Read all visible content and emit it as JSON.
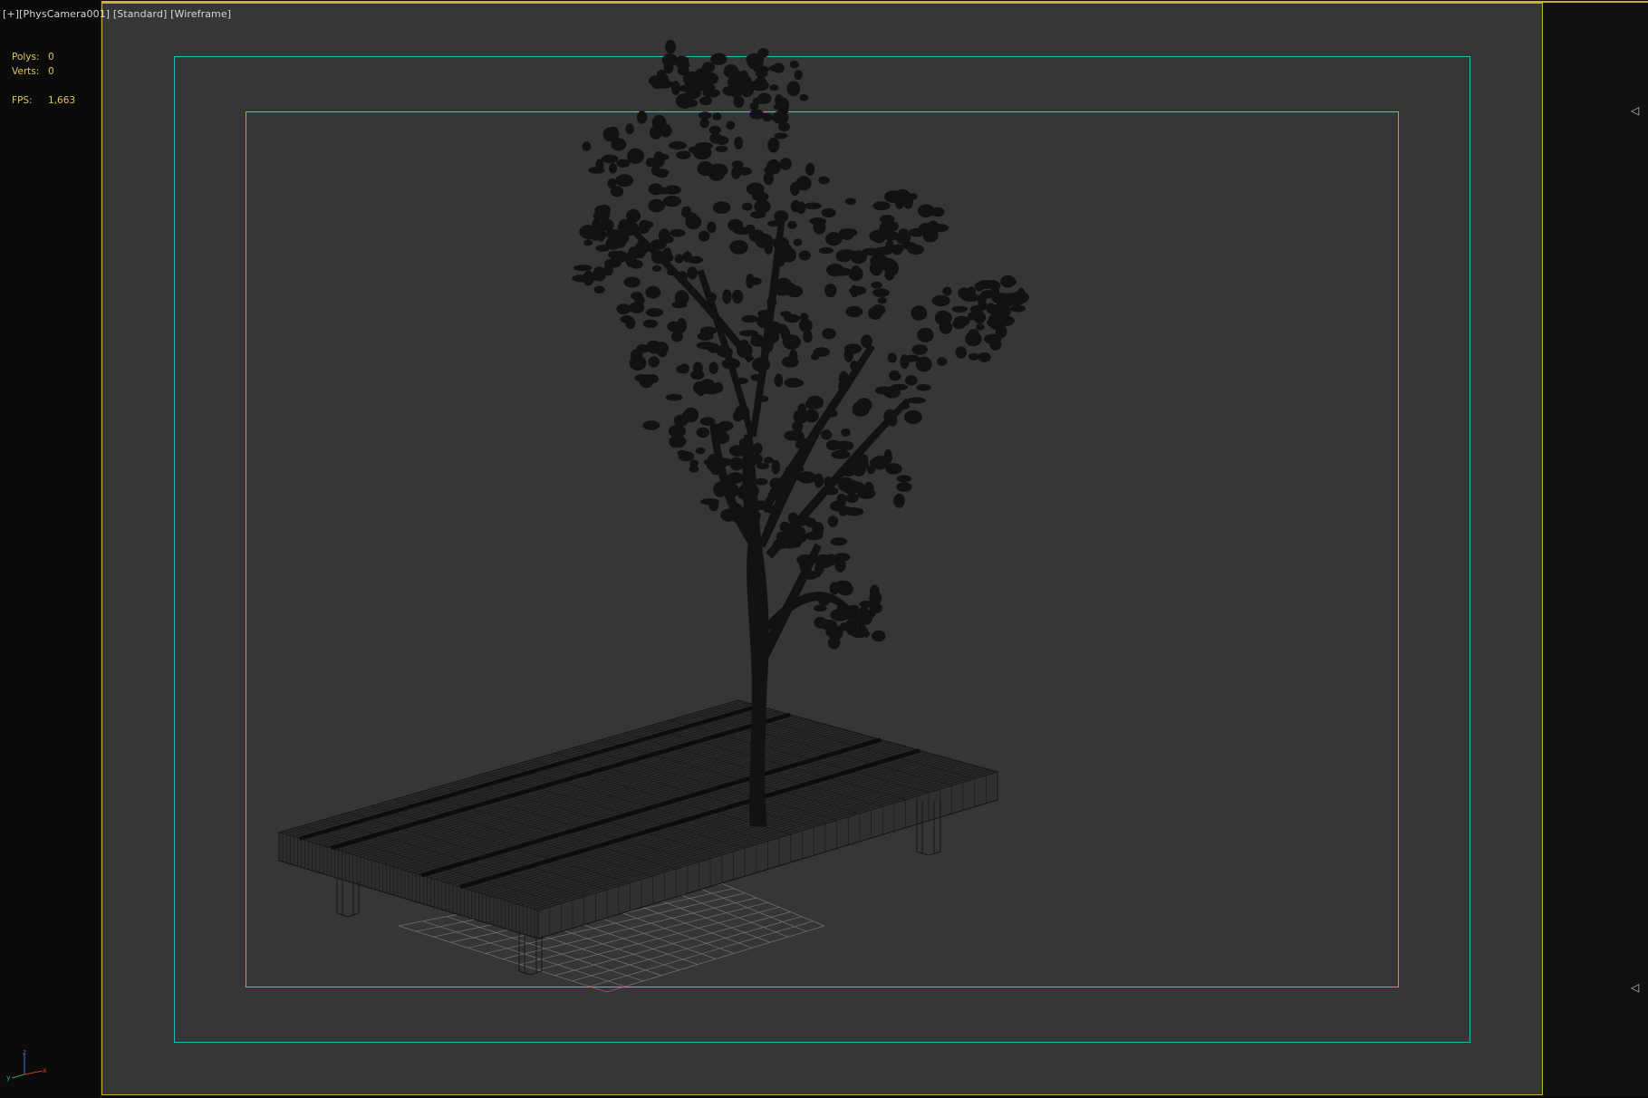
{
  "viewport": {
    "label_parts": [
      "[+]",
      "[PhysCamera001]",
      "[Standard]",
      "[Wireframe]"
    ]
  },
  "stats": {
    "polys_label": "Polys:",
    "polys_value": "0",
    "verts_label": "Verts:",
    "verts_value": "0",
    "fps_label": "FPS:",
    "fps_value": "1,663"
  },
  "gizmo": {
    "x": "x",
    "y": "y",
    "z": "z"
  },
  "side_arrows": [
    "◁",
    "◁"
  ],
  "colors": {
    "viewport_bg": "#363636",
    "viewport_border": "#cdb033",
    "safe_frame_outer": "#1fb7c9",
    "safe_frame_inner": "#d49a15",
    "stats_text": "#e2c55c",
    "label_text": "#d6d6d6",
    "wireframe": "#0d0d0d"
  }
}
